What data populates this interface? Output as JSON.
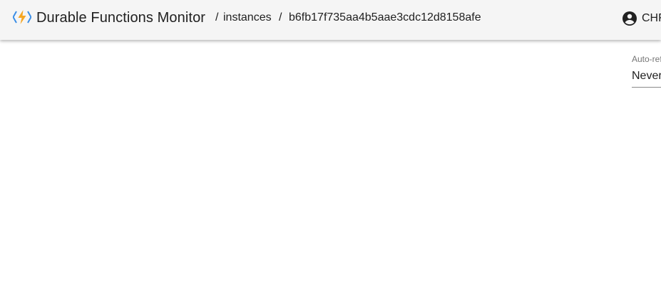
{
  "header": {
    "app_title": "Durable Functions Monitor",
    "breadcrumb": {
      "separator": "/",
      "instances_label": "instances",
      "instance_id": "b6fb17f735aa4b5aae3cdc12d8158afe"
    },
    "user_name": "CHF"
  },
  "auto_refresh": {
    "label": "Auto-refresh",
    "value": "Never"
  },
  "icons": {
    "logo": "durable-functions-logo",
    "user": "account-circle-icon"
  },
  "colors": {
    "appbar_bg": "#f5f5f5",
    "logo_orange": "#f5a623",
    "logo_blue": "#3a8ee6",
    "text": "#212121",
    "muted_text": "#757575"
  }
}
